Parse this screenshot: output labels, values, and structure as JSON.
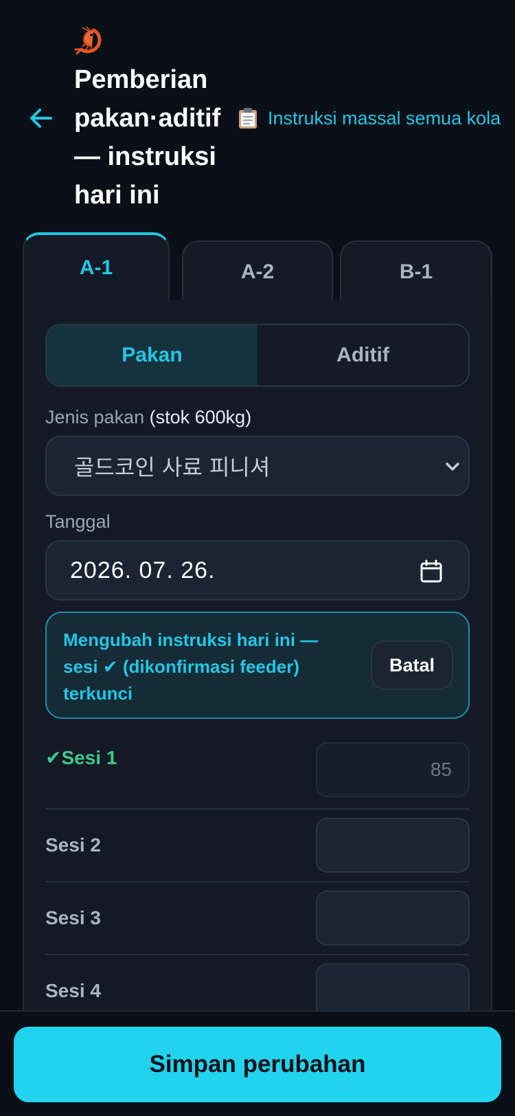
{
  "header": {
    "title": "Pemberian pakan·aditif — instruksi hari ini",
    "mass_instruction_label": "Instruksi massal semua kola"
  },
  "tabs": [
    {
      "label": "A-1",
      "active": true
    },
    {
      "label": "A-2",
      "active": false
    },
    {
      "label": "B-1",
      "active": false
    }
  ],
  "segment": {
    "options": [
      "Pakan",
      "Aditif"
    ],
    "selected": "Pakan"
  },
  "feed_type": {
    "label": "Jenis pakan",
    "stock": "(stok 600kg)",
    "value": "골드코인 사료 피니셔"
  },
  "date": {
    "label": "Tanggal",
    "value": "2026. 07. 26."
  },
  "notice": {
    "text": "Mengubah instruksi hari ini — sesi ✔ (dikonfirmasi feeder) terkunci",
    "cancel_label": "Batal"
  },
  "sessions": [
    {
      "label": "✔Sesi 1",
      "value": "85",
      "confirmed": true
    },
    {
      "label": "Sesi 2",
      "value": "",
      "confirmed": false
    },
    {
      "label": "Sesi 3",
      "value": "",
      "confirmed": false
    },
    {
      "label": "Sesi 4",
      "value": "",
      "confirmed": false
    }
  ],
  "footer": {
    "save_label": "Simpan perubahan"
  },
  "colors": {
    "accent": "#22c7e6",
    "confirmed": "#3ec98b",
    "background": "#0b1018",
    "save_button": "#22d3ee"
  },
  "icons": [
    "shrimp-logo-icon",
    "back-arrow-icon",
    "clipboard-icon",
    "chevron-down-icon",
    "calendar-icon"
  ]
}
